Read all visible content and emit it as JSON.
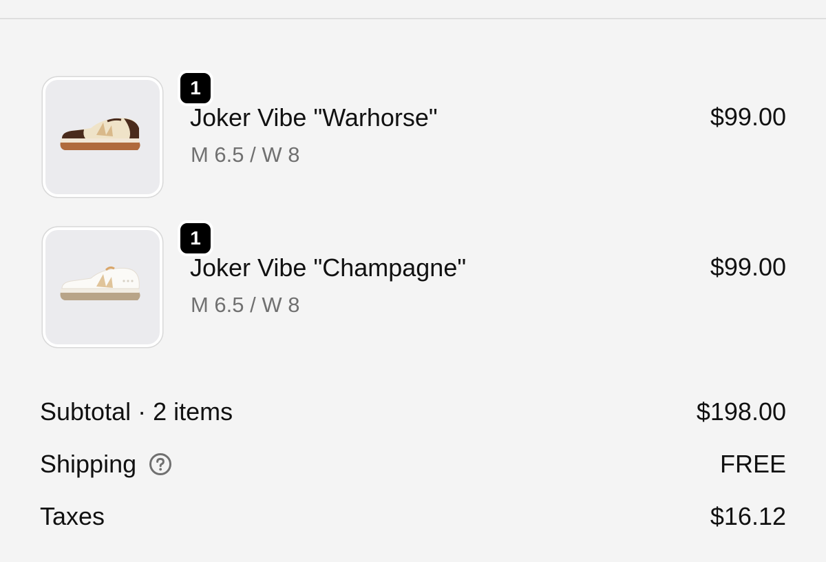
{
  "cart": {
    "items": [
      {
        "quantity": "1",
        "name": "Joker Vibe \"Warhorse\"",
        "variant": "M 6.5 / W 8",
        "price": "$99.00",
        "image_icon": "sneaker-image",
        "colors": {
          "upper": "#efe3c8",
          "accent": "#4a2b1c",
          "sole": "#b06a3c",
          "midsole": "#f2e7d6"
        }
      },
      {
        "quantity": "1",
        "name": "Joker Vibe \"Champagne\"",
        "variant": "M 6.5 / W 8",
        "price": "$99.00",
        "image_icon": "sneaker-image",
        "colors": {
          "upper": "#fbfaf7",
          "accent": "#e0c49a",
          "sole": "#b8a488",
          "midsole": "#f1ece3"
        }
      }
    ]
  },
  "summary": {
    "subtotal_label": "Subtotal · 2 items",
    "subtotal_value": "$198.00",
    "shipping_label": "Shipping",
    "shipping_value": "FREE",
    "shipping_help_icon": "question-circle-icon",
    "taxes_label": "Taxes",
    "taxes_value": "$16.12"
  },
  "colors": {
    "background": "#f4f4f4",
    "text": "#111111",
    "muted_text": "#707070",
    "badge_bg": "#000000"
  }
}
